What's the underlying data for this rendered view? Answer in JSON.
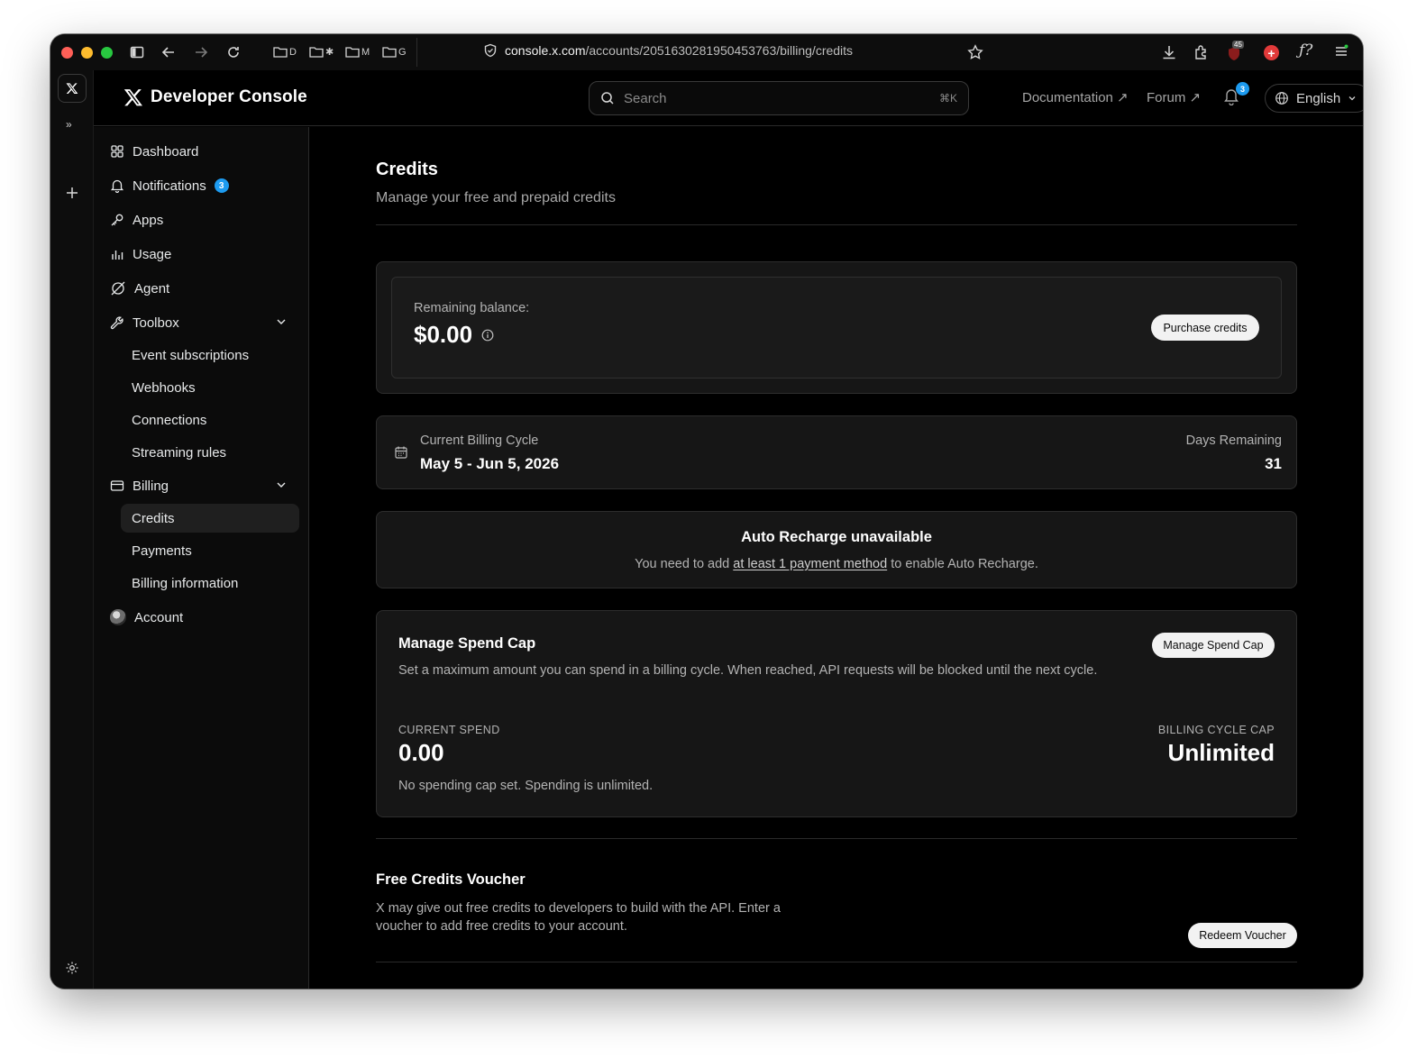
{
  "browser": {
    "url_host": "console.x.com",
    "url_path": "/accounts/2051630281950453763/billing/credits",
    "bookmarks": [
      "D",
      "M",
      "G"
    ],
    "extension_badge": "45"
  },
  "header": {
    "brand": "Developer Console",
    "search_placeholder": "Search",
    "search_shortcut": "⌘K",
    "links": {
      "documentation": "Documentation ↗",
      "forum": "Forum ↗"
    },
    "notification_count": "3",
    "language": "English"
  },
  "sidebar": {
    "dashboard": "Dashboard",
    "notifications": "Notifications",
    "notifications_count": "3",
    "apps": "Apps",
    "usage": "Usage",
    "agent": "Agent",
    "toolbox": "Toolbox",
    "toolbox_items": [
      "Event subscriptions",
      "Webhooks",
      "Connections",
      "Streaming rules"
    ],
    "billing": "Billing",
    "billing_items": [
      "Credits",
      "Payments",
      "Billing information"
    ],
    "account": "Account"
  },
  "page": {
    "title": "Credits",
    "subtitle": "Manage your free and prepaid credits"
  },
  "balance": {
    "label": "Remaining balance:",
    "amount": "$0.00",
    "purchase_button": "Purchase credits"
  },
  "billing_cycle": {
    "label": "Current Billing Cycle",
    "range": "May 5 - Jun 5, 2026",
    "days_label": "Days Remaining",
    "days": "31"
  },
  "auto_recharge": {
    "title": "Auto Recharge unavailable",
    "text_before": "You need to add ",
    "link": "at least 1 payment method",
    "text_after": " to enable Auto Recharge."
  },
  "spend_cap": {
    "title": "Manage Spend Cap",
    "description": "Set a maximum amount you can spend in a billing cycle. When reached, API requests will be blocked until the next cycle.",
    "button": "Manage Spend Cap",
    "current_label": "CURRENT SPEND",
    "current_value": "0.00",
    "cap_label": "BILLING CYCLE CAP",
    "cap_value": "Unlimited",
    "note": "No spending cap set. Spending is unlimited."
  },
  "voucher": {
    "title": "Free Credits Voucher",
    "description_line1": "X may give out free credits to developers to build with the API. Enter a",
    "description_line2": "voucher to add free credits to your account.",
    "button": "Redeem Voucher"
  },
  "colors": {
    "accent": "#1d9bf0",
    "background": "#000000",
    "card": "#161616"
  }
}
